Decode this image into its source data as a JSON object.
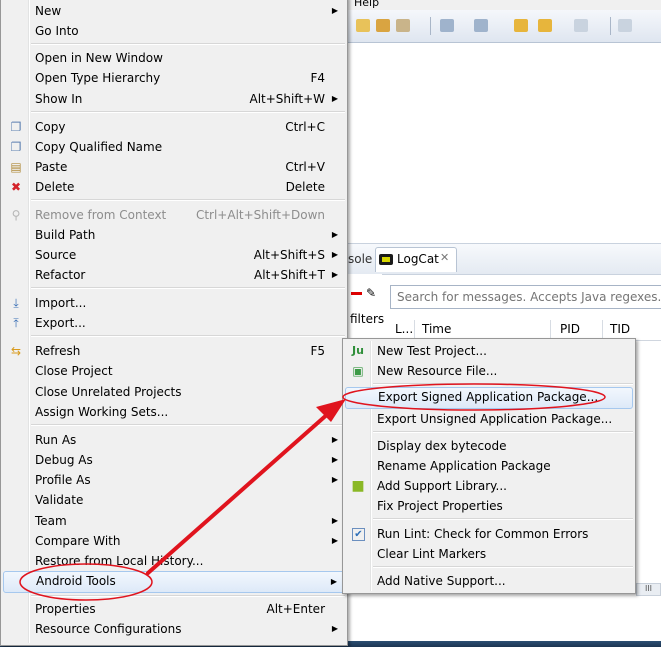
{
  "ide": {
    "menubar_help": "Help",
    "panel_tab_console": "sole",
    "panel_tab_logcat": "LogCat",
    "tab_close_glyph": "✕",
    "filters_label": "filters",
    "search_placeholder": "Search for messages. Accepts Java regexes. Prefix",
    "columns": [
      "L...",
      "Time",
      "PID",
      "TID"
    ],
    "scroll_glyph": "III"
  },
  "context_menu": {
    "new": "New",
    "go_into": "Go Into",
    "open_new_window": "Open in New Window",
    "open_type_hierarchy": "Open Type Hierarchy",
    "open_type_hierarchy_acc": "F4",
    "show_in": "Show In",
    "show_in_acc": "Alt+Shift+W",
    "copy": "Copy",
    "copy_acc": "Ctrl+C",
    "copy_qualified": "Copy Qualified Name",
    "paste": "Paste",
    "paste_acc": "Ctrl+V",
    "delete": "Delete",
    "delete_acc": "Delete",
    "remove_context": "Remove from Context",
    "remove_context_acc": "Ctrl+Alt+Shift+Down",
    "build_path": "Build Path",
    "source": "Source",
    "source_acc": "Alt+Shift+S",
    "refactor": "Refactor",
    "refactor_acc": "Alt+Shift+T",
    "import": "Import...",
    "export": "Export...",
    "refresh": "Refresh",
    "refresh_acc": "F5",
    "close_project": "Close Project",
    "close_unrelated": "Close Unrelated Projects",
    "assign_sets": "Assign Working Sets...",
    "run_as": "Run As",
    "debug_as": "Debug As",
    "profile_as": "Profile As",
    "validate": "Validate",
    "team": "Team",
    "compare_with": "Compare With",
    "restore_history": "Restore from Local History...",
    "android_tools": "Android Tools",
    "properties": "Properties",
    "properties_acc": "Alt+Enter",
    "resource_configs": "Resource Configurations"
  },
  "submenu": {
    "new_test_project": "New Test Project...",
    "new_resource_file": "New Resource File...",
    "export_signed": "Export Signed Application Package...",
    "export_unsigned": "Export Unsigned Application Package...",
    "display_dex": "Display dex bytecode",
    "rename_package": "Rename Application Package",
    "add_support_lib": "Add Support Library...",
    "fix_properties": "Fix Project Properties",
    "run_lint": "Run Lint: Check for Common Errors",
    "clear_lint": "Clear Lint Markers",
    "add_native": "Add Native Support..."
  },
  "colors": {
    "annotation_red": "#e0141e",
    "highlight_border": "#a6c8ee",
    "menu_bg": "#f0f0f0"
  }
}
